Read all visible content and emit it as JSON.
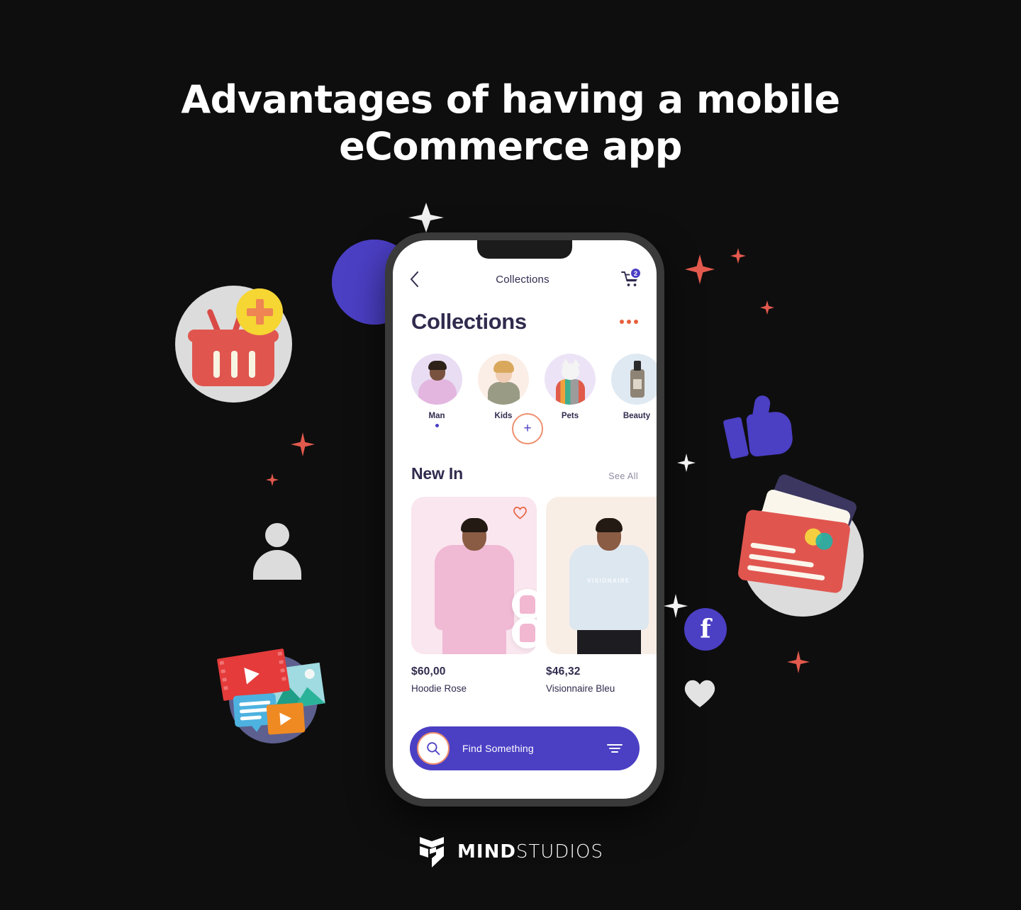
{
  "headline": {
    "line1": "Advantages of having a mobile",
    "line2": "eCommerce app"
  },
  "phone": {
    "navbar": {
      "back_icon": "chevron-left-icon",
      "title": "Collections",
      "cart_icon": "shopping-cart-icon",
      "cart_badge": "2"
    },
    "page_title": "Collections",
    "more_menu": "three-dots-icon",
    "categories": [
      {
        "label": "Man",
        "active": true
      },
      {
        "label": "Kids",
        "active": false
      },
      {
        "label": "Pets",
        "active": false
      },
      {
        "label": "Beauty",
        "active": false
      }
    ],
    "section": {
      "title": "New In",
      "see_all": "See All"
    },
    "products": [
      {
        "price": "$60,00",
        "name": "Hoodie Rose",
        "favorite_icon": "heart-outline-icon",
        "brand_print": "",
        "bg": "#fae6ef"
      },
      {
        "price": "$46,32",
        "name": "Visionnaire Bleu",
        "favorite_icon": "heart-outline-icon",
        "brand_print": "VISIONAIRE",
        "bg": "#f9eee6"
      }
    ],
    "add_button": "+",
    "search": {
      "icon": "search-icon",
      "placeholder": "Find Something",
      "filter_icon": "filter-icon"
    }
  },
  "decorations": [
    {
      "name": "shopping-basket-icon"
    },
    {
      "name": "person-icon"
    },
    {
      "name": "media-collage-icon"
    },
    {
      "name": "thumbs-up-icon"
    },
    {
      "name": "credit-cards-icon"
    },
    {
      "name": "facebook-icon"
    },
    {
      "name": "heart-icon"
    },
    {
      "name": "sparkle-icon"
    }
  ],
  "footer": {
    "logo_mark": "mindstudios-logo-icon",
    "logo_bold": "MIND",
    "logo_light": "STUDIOS"
  },
  "colors": {
    "background": "#0e0e0e",
    "accent_purple": "#4b3fc4",
    "accent_coral": "#e8603c",
    "text_dark": "#302b4e",
    "text_muted": "#8d8ba0"
  }
}
